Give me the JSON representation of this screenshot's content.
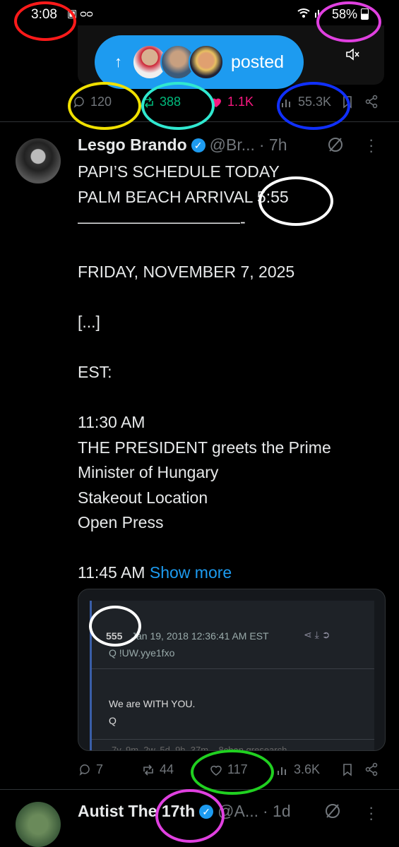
{
  "status_bar": {
    "time": "3:08",
    "battery": "58%"
  },
  "posted_pill": {
    "label": "posted"
  },
  "prev_tweet_actions": {
    "replies": "120",
    "reposts": "388",
    "likes": "1.1K",
    "views": "55.3K"
  },
  "tweet": {
    "author_name": "Lesgo Brando",
    "handle": "@Br...",
    "time": "· 7h",
    "body": "PAPI’S SCHEDULE TODAY\nPALM BEACH ARRIVAL 5:55\n——————————-\n\nFRIDAY, NOVEMBER 7, 2025\n\n[...]\n\nEST:\n\n11:30 AM\n THE PRESIDENT greets the Prime\nMinister of Hungary\nStakeout Location\nOpen Press\n\n11:45 AM ",
    "show_more": "Show more",
    "quote": {
      "post_number": "555",
      "date_text": "Jan 19, 2018 12:36:41 AM EST",
      "tripcode": "Q !UW.yye1fxo",
      "message": "We are WITH YOU.",
      "signoff": "Q",
      "footer": "7y, 9m, 2w, 5d, 9h, 37m    8chan qresearch"
    },
    "actions": {
      "replies": "7",
      "reposts": "44",
      "likes": "117",
      "views": "3.6K"
    }
  },
  "next_tweet": {
    "author_name": "Autist The 17th",
    "handle": "@A...",
    "time": "· 1d"
  },
  "colors": {
    "background": "#000000",
    "accent_blue": "#1d9bf0",
    "repost_green": "#00ba7c",
    "like_pink": "#f91880",
    "annotation_red": "#ff1a1a",
    "annotation_magenta": "#e040e0",
    "annotation_yellow": "#f0e000",
    "annotation_cyan": "#30e8d0",
    "annotation_blue": "#1030ff",
    "annotation_white": "#ffffff",
    "annotation_green": "#20d020"
  }
}
